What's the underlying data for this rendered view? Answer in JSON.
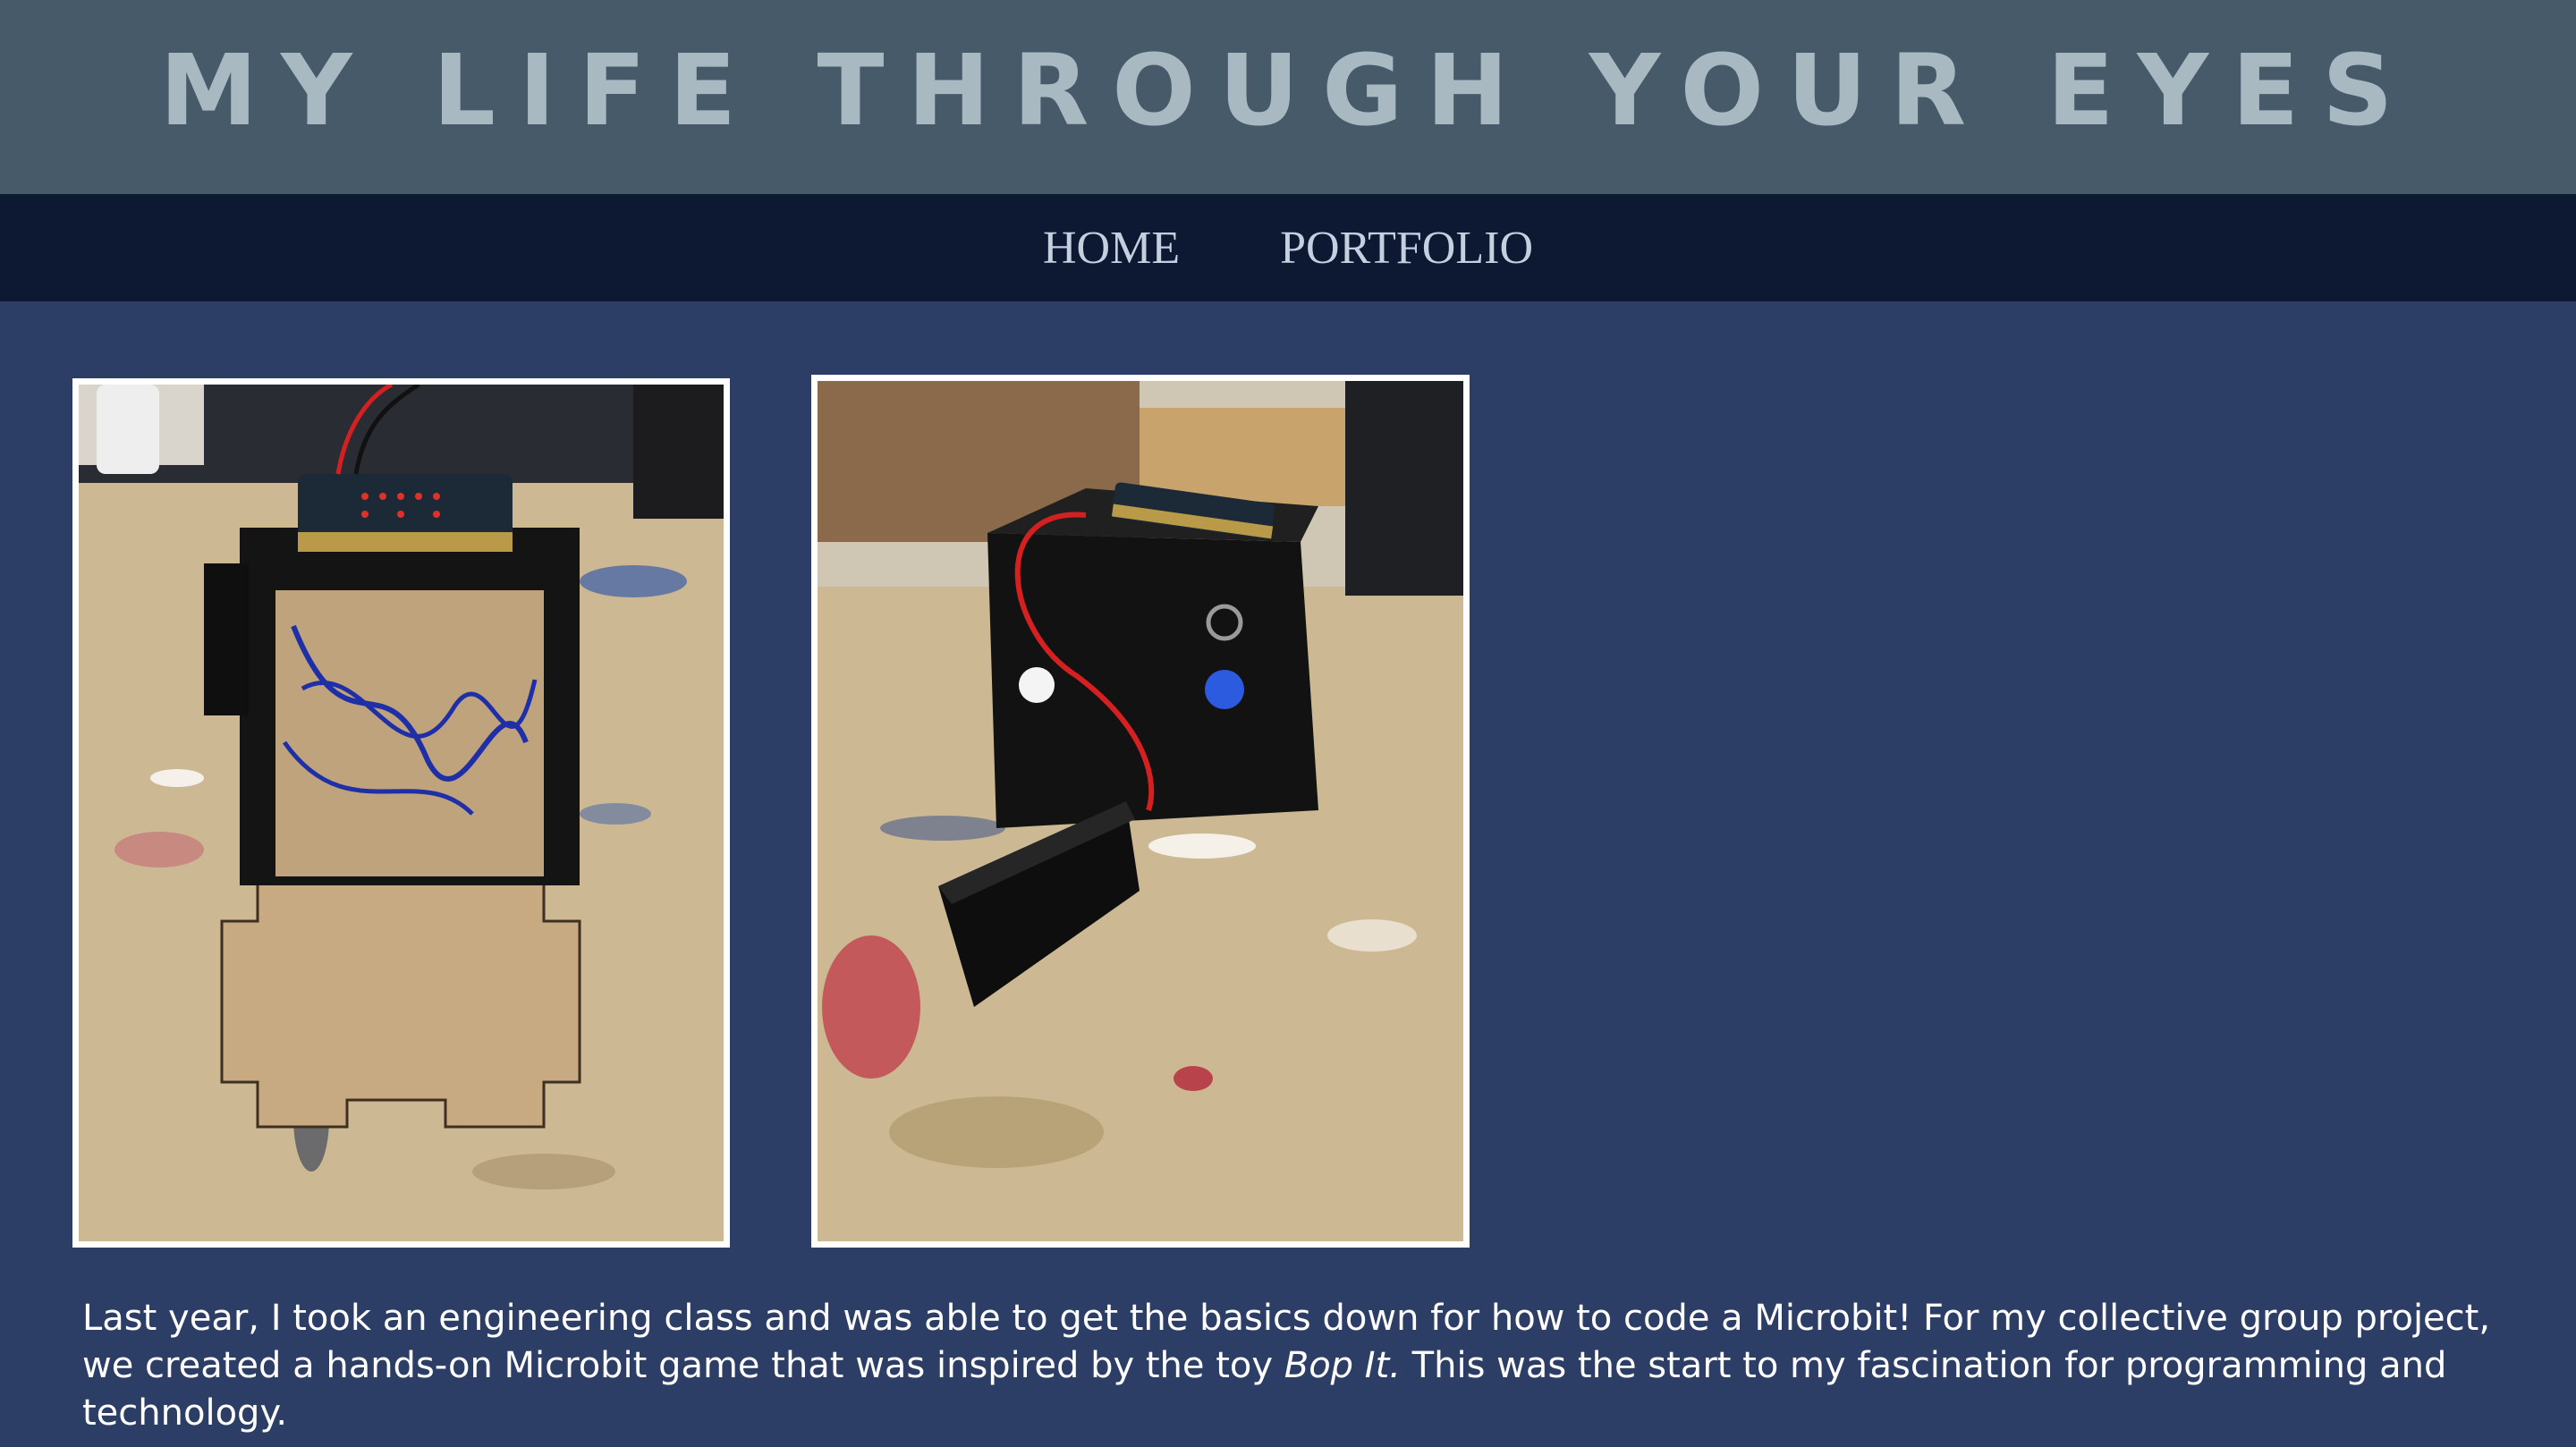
{
  "header": {
    "title": "MY LIFE THROUGH YOUR EYES"
  },
  "nav": {
    "items": [
      {
        "label": "HOME"
      },
      {
        "label": "PORTFOLIO"
      }
    ]
  },
  "colors": {
    "header_bg": "#465a6a",
    "title_text": "#a9b9c2",
    "nav_bg": "#0d1833",
    "nav_text": "#c5cfe0",
    "page_bg": "#2d3e66",
    "body_text": "#ffffff"
  },
  "caption": {
    "part1": "Last year, I took an engineering class and was able to get the basics down for how to code a Microbit! For my collective group project, we created a hands-on Microbit game that was inspired by the toy ",
    "emphasis": "Bop It.",
    "part2": " This was the start to my fascination for programming and technology."
  }
}
